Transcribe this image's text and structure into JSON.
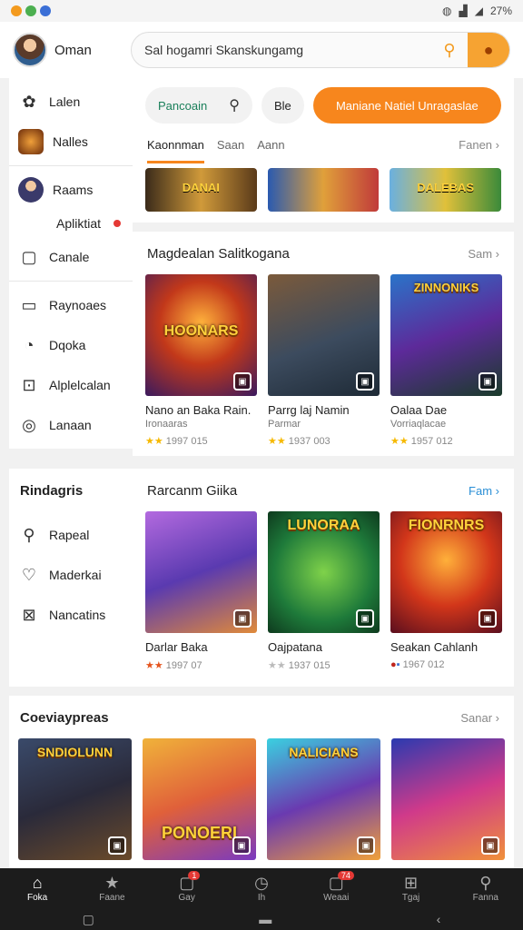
{
  "status": {
    "right_text": "27%"
  },
  "header": {
    "user_name": "Oman",
    "search_value": "Sal hogamri Skanskungamg"
  },
  "sidebar": {
    "items": [
      {
        "label": "Lalen",
        "icon": "settings-fan-icon"
      },
      {
        "label": "Nalles",
        "icon": "game-thumb-icon"
      },
      {
        "label": "Raams",
        "icon": "avatar-thumb-icon"
      },
      {
        "label": "Apliktiat",
        "icon": ""
      },
      {
        "label": "Canale",
        "icon": "phone-icon"
      },
      {
        "label": "Raynoaes",
        "icon": "document-icon"
      },
      {
        "label": "Dqoka",
        "icon": "alarm-icon"
      },
      {
        "label": "Alplelcalan",
        "icon": "app-icon"
      },
      {
        "label": "Lanaan",
        "icon": "globe-icon"
      }
    ]
  },
  "chips": {
    "first": "Pancoain",
    "second": "Ble",
    "cta": "Maniane Natiel Unragaslae"
  },
  "tabs": {
    "items": [
      "Kaonnman",
      "Saan",
      "Aann"
    ],
    "more": "Fanen"
  },
  "section1": {
    "title": "Magdealan Salitkogana",
    "more": "Sam",
    "games": [
      {
        "name": "Nano an Baka Rain.",
        "sub": "Ironaaras",
        "meta": "1997 015",
        "logo": "HOONARS",
        "grad": "radial-gradient(circle at 50% 40%,#ffb23c,#c2381a 45%,#3b1a5e)"
      },
      {
        "name": "Parrg laj Namin",
        "sub": "Parmar",
        "meta": "1937 003",
        "logo": "",
        "grad": "linear-gradient(160deg,#7b5a3b,#3c4b5e 55%,#1e2a36)"
      },
      {
        "name": "Oalaa Dae",
        "sub": "Vorriaqlacae",
        "meta": "1957 012",
        "logo": "ZINNONIKS",
        "grad": "linear-gradient(160deg,#2a74c9,#5d2a9a 50%,#1a3b2a)"
      }
    ]
  },
  "section2": {
    "side_title": "Rindagris",
    "side_items": [
      {
        "label": "Rapeal",
        "icon": "search-icon"
      },
      {
        "label": "Maderkai",
        "icon": "heart-icon"
      },
      {
        "label": "Nancatins",
        "icon": "close-box-icon"
      }
    ],
    "title": "Rarcanm Giika",
    "more": "Fam",
    "games": [
      {
        "name": "Darlar Baka",
        "meta": "1997 07",
        "logo": "",
        "grad": "linear-gradient(160deg,#b36adf,#5a3ab0 50%,#e08a3a)"
      },
      {
        "name": "Oajpatana",
        "meta": "1937 015",
        "logo": "LUNORAA",
        "grad": "radial-gradient(circle at 50% 50%,#7fd24a,#1e7a3a 60%,#0e3a1e)"
      },
      {
        "name": "Seakan Cahlanh",
        "meta": "1967 012",
        "logo": "FIONRNRS",
        "grad": "radial-gradient(circle at 50% 40%,#ffb03a,#d2361a 50%,#5a0e1e)"
      }
    ]
  },
  "section3": {
    "title": "Coeviaypreas",
    "more": "Sanar",
    "games": [
      {
        "logo": "SNDIOLUNN",
        "grad": "linear-gradient(160deg,#3a4a6a,#2a2a3a 50%,#6a4a2a)"
      },
      {
        "logo": "PONOERI",
        "grad": "linear-gradient(160deg,#f0b23a,#e0603a 50%,#7a3ac0)"
      },
      {
        "logo": "NALICIANS",
        "grad": "linear-gradient(160deg,#3ad0e0,#6a3ab0 50%,#f0a03a)"
      },
      {
        "logo": "",
        "grad": "linear-gradient(160deg,#2a3ab0,#d03a8a 50%,#f0903a)"
      }
    ]
  },
  "banners": [
    {
      "logo": "DANAI",
      "grad": "linear-gradient(90deg,#3a2a1a,#d09a3a,#5a3a1a)"
    },
    {
      "logo": "",
      "grad": "linear-gradient(90deg,#2a5ab0,#e0a03a,#c03a3a)"
    },
    {
      "logo": "DALEBAS",
      "grad": "linear-gradient(90deg,#6ab0e0,#e0c03a,#3a8a3a)"
    }
  ],
  "nav": {
    "items": [
      {
        "label": "Foka",
        "icon": "home-icon",
        "badge": ""
      },
      {
        "label": "Faane",
        "icon": "star-icon",
        "badge": ""
      },
      {
        "label": "Gay",
        "icon": "bag-icon",
        "badge": "1"
      },
      {
        "label": "Ih",
        "icon": "clock-icon",
        "badge": ""
      },
      {
        "label": "Weaai",
        "icon": "bag-icon",
        "badge": "74"
      },
      {
        "label": "Tgaj",
        "icon": "grid-icon",
        "badge": ""
      },
      {
        "label": "Fanna",
        "icon": "search-icon",
        "badge": ""
      }
    ]
  }
}
